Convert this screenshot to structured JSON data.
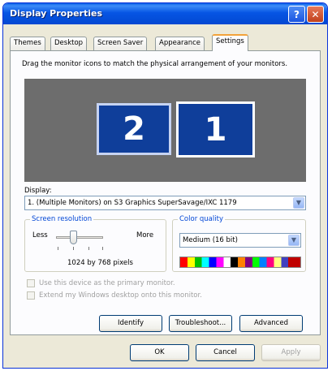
{
  "window": {
    "title": "Display Properties",
    "help_label": "?",
    "close_label": "✕"
  },
  "tabs": [
    {
      "label": "Themes"
    },
    {
      "label": "Desktop"
    },
    {
      "label": "Screen Saver"
    },
    {
      "label": "Appearance"
    },
    {
      "label": "Settings"
    }
  ],
  "active_tab": "Settings",
  "settings": {
    "instruction": "Drag the monitor icons to match the physical arrangement of your monitors.",
    "monitors": [
      {
        "number": "2"
      },
      {
        "number": "1"
      }
    ],
    "display_label": "Display:",
    "display_value": "1. (Multiple Monitors) on S3 Graphics SuperSavage/IXC 1179",
    "resolution": {
      "legend": "Screen resolution",
      "less_label": "Less",
      "more_label": "More",
      "value_text": "1024 by 768 pixels"
    },
    "color_quality": {
      "legend": "Color quality",
      "value": "Medium (16 bit)"
    },
    "checkbox_primary": "Use this device as the primary monitor.",
    "checkbox_extend": "Extend my Windows desktop onto this monitor.",
    "identify_label": "Identify",
    "troubleshoot_label": "Troubleshoot...",
    "advanced_label": "Advanced"
  },
  "footer": {
    "ok_label": "OK",
    "cancel_label": "Cancel",
    "apply_label": "Apply"
  }
}
